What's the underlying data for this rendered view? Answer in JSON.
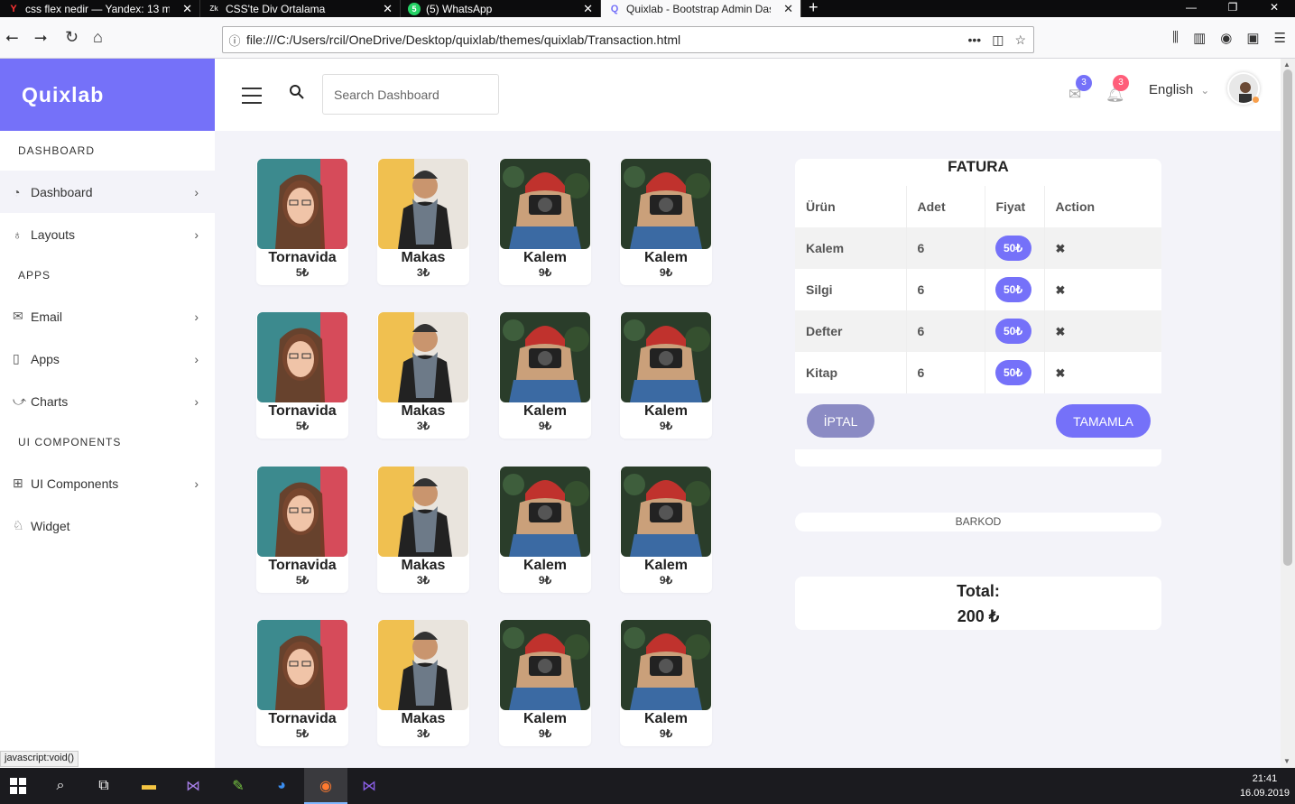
{
  "browser": {
    "tabs": [
      {
        "title": "css flex nedir — Yandex: 13 milli",
        "favicon": "Y"
      },
      {
        "title": "CSS'te Div Ortalama",
        "favicon": "Zk"
      },
      {
        "title": "(5) WhatsApp",
        "favicon": "W"
      },
      {
        "title": "Quixlab - Bootstrap Admin Das",
        "favicon": "Q"
      }
    ],
    "new_tab": "+",
    "url": "file:///C:/Users/rcil/OneDrive/Desktop/quixlab/themes/quixlab/Transaction.html",
    "status_text": "javascript:void()"
  },
  "app": {
    "brand": "Quixlab",
    "search_placeholder": "Search Dashboard",
    "mail_count": "3",
    "notif_count": "3",
    "language": "English"
  },
  "sidebar": {
    "section_dashboard": "DASHBOARD",
    "dashboard": "Dashboard",
    "layouts": "Layouts",
    "section_apps": "APPS",
    "email": "Email",
    "apps": "Apps",
    "charts": "Charts",
    "section_ui": "UI COMPONENTS",
    "ui_components": "UI Components",
    "widget": "Widget"
  },
  "products": [
    {
      "name": "Tornavida",
      "price": "5₺"
    },
    {
      "name": "Makas",
      "price": "3₺"
    },
    {
      "name": "Kalem",
      "price": "9₺"
    },
    {
      "name": "Kalem",
      "price": "9₺"
    }
  ],
  "invoice": {
    "title": "FATURA",
    "headers": [
      "Ürün",
      "Adet",
      "Fiyat",
      "Action"
    ],
    "rows": [
      {
        "product": "Kalem",
        "qty": "6",
        "price": "50₺"
      },
      {
        "product": "Silgi",
        "qty": "6",
        "price": "50₺"
      },
      {
        "product": "Defter",
        "qty": "6",
        "price": "50₺"
      },
      {
        "product": "Kitap",
        "qty": "6",
        "price": "50₺"
      }
    ],
    "cancel": "İPTAL",
    "complete": "TAMAMLA"
  },
  "barcode": "BARKOD",
  "total": {
    "label": "Total:",
    "value": "200 ₺"
  },
  "taskbar": {
    "time": "21:41",
    "date": "16.09.2019"
  },
  "colors": {
    "accent": "#7571f9",
    "page_bg": "#f3f3f9"
  }
}
